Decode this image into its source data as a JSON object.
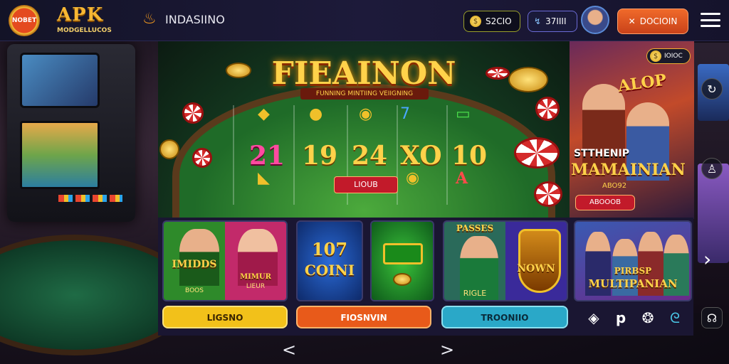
{
  "header": {
    "logo_badge_text": "NOBET",
    "brand": "APK",
    "brand_sub": "MODGELLUCOS",
    "app_name": "INDASIINO",
    "coins_value": "S2CIO",
    "gems_value": "37IIII",
    "action_label": "DOCIOIN"
  },
  "stage": {
    "title": "FIEAINON",
    "tagline": "FUNNING MINTIING VEIIGNING",
    "reels": [
      "21",
      "19",
      "24",
      "XO",
      "10"
    ],
    "button_label": "LIOUB"
  },
  "promo": {
    "coin_label": "IOIOC",
    "badge": "ALOP",
    "title_line1": "STTHENIP",
    "title_line2": "MAMAINIAN",
    "subtitle": "ABO92",
    "button_label": "ABOOOB"
  },
  "tiles": [
    {
      "title": "IMIDDS",
      "sub": "BOOS",
      "title2": "MIMUR",
      "sub2": "LIEUR"
    },
    {
      "title": "107",
      "title2": "COINI"
    },
    {
      "title": "PASSES",
      "sub": "RIGLE",
      "title2": "NOWN"
    },
    {
      "title": "PIRBSP",
      "title2": "MULTIPANIAN"
    }
  ],
  "categories": [
    {
      "label": "LIGSNO",
      "color": "#f2c11a"
    },
    {
      "label": "FIOSNVIN",
      "color": "#e85a1a"
    },
    {
      "label": "TROONIIO",
      "color": "#2aa8c8"
    }
  ],
  "social_icons": [
    "diamond-icon",
    "p-icon",
    "discord-icon",
    "chat-icon"
  ],
  "colors": {
    "accent": "#f7b733",
    "header_bg": "#1a1a35"
  }
}
